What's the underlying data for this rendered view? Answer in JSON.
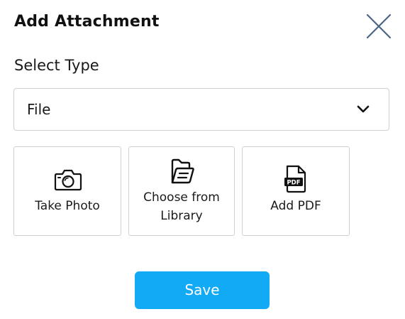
{
  "dialog": {
    "title": "Add Attachment",
    "close_icon": "close-icon"
  },
  "select": {
    "label": "Select Type",
    "value": "File",
    "chevron_icon": "chevron-down-icon"
  },
  "tiles": [
    {
      "label": "Take Photo",
      "icon": "camera-icon"
    },
    {
      "label_lines": [
        "Choose from",
        "Library"
      ],
      "icon": "folder-icon"
    },
    {
      "label": "Add PDF",
      "icon": "pdf-file-icon",
      "icon_text": "PDF"
    }
  ],
  "actions": {
    "save_label": "Save"
  },
  "colors": {
    "accent": "#12aaf5",
    "close_icon": "#4a6585",
    "border": "#cfcfcf"
  }
}
